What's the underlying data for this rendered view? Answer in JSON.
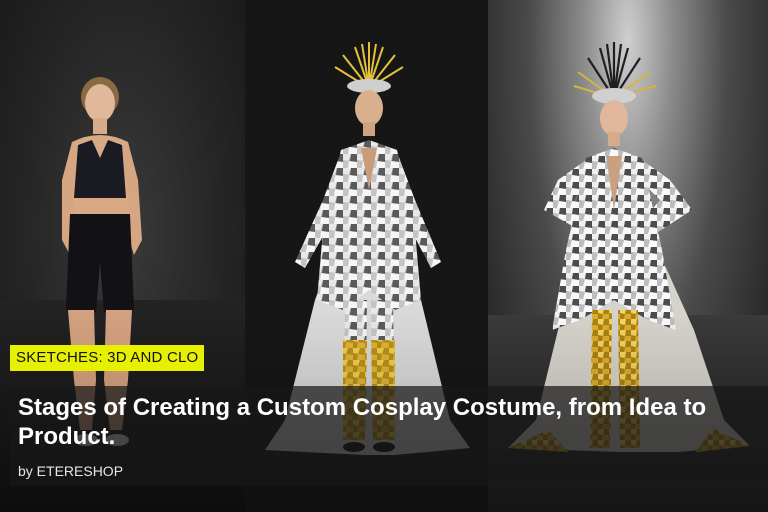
{
  "post": {
    "category": "SKETCHES: 3D AND CLO",
    "title": "Stages of Creating a Custom Cosplay Costume, from Idea to Product.",
    "byline": "by ETERESHOP"
  },
  "colors": {
    "tag_background": "#e6f000",
    "tag_text": "#111111",
    "title_text": "#ffffff",
    "text_box": "rgba(24,24,24,0.72)"
  }
}
